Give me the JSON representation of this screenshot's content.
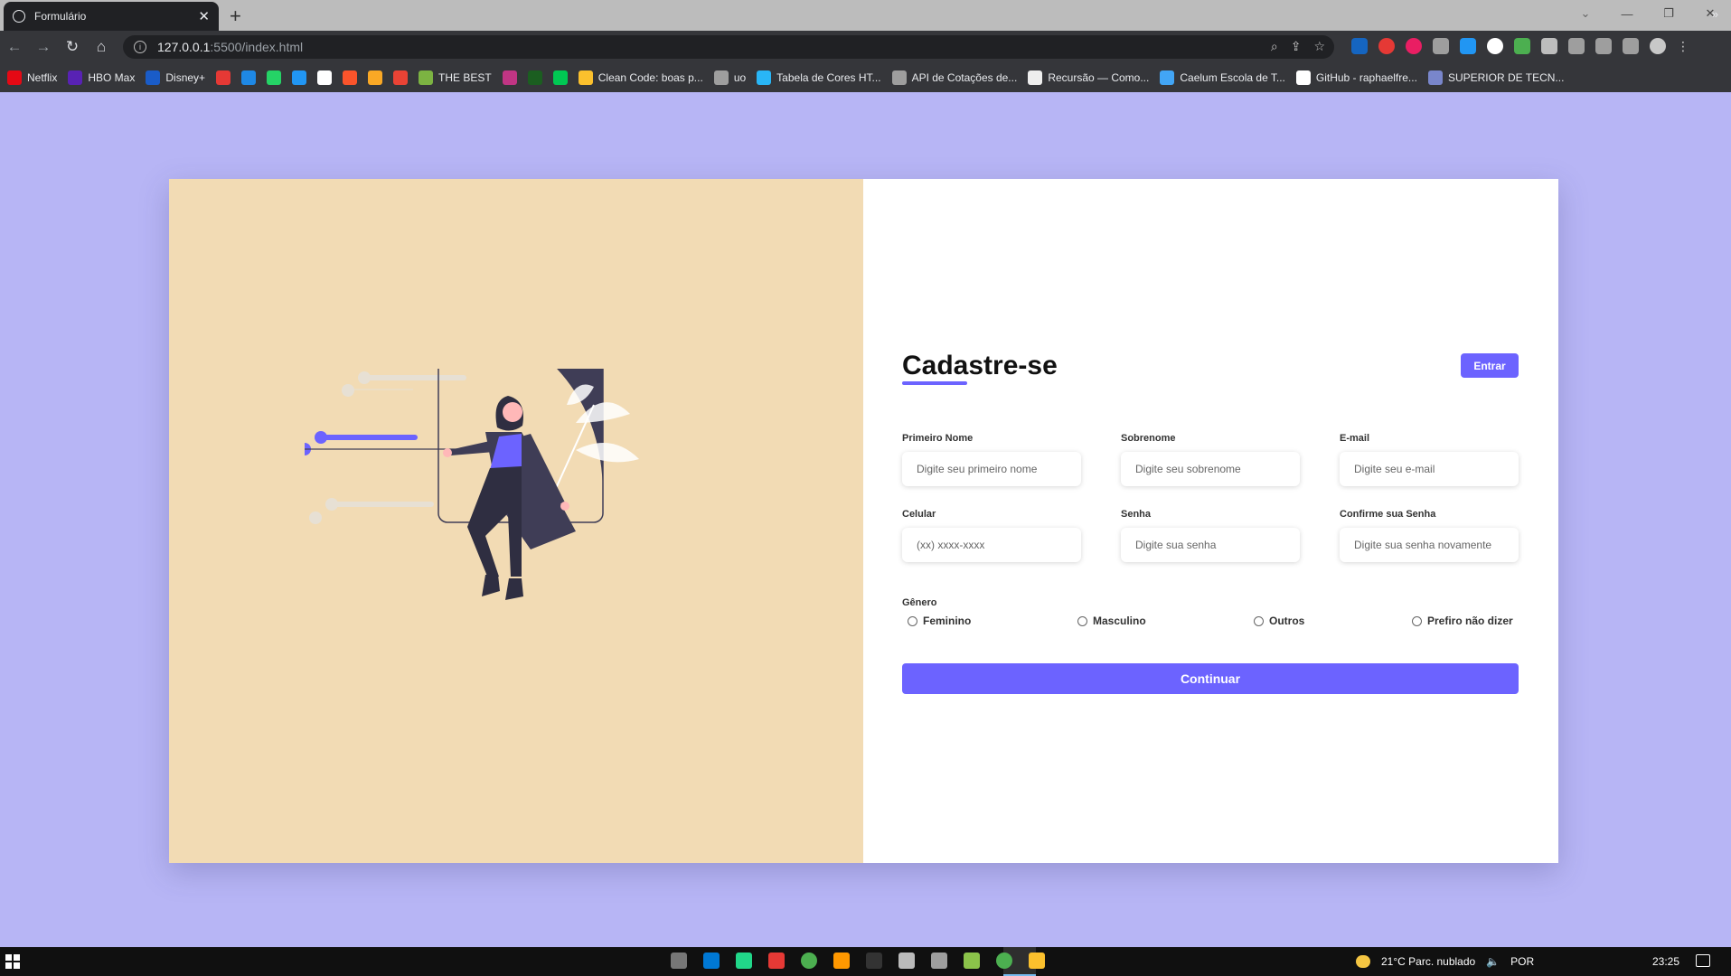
{
  "browser": {
    "tab_title": "Formulário",
    "new_tab": "+",
    "url_host": "127.0.0.1",
    "url_path": ":5500/index.html",
    "window_controls": {
      "tabs_list": "⌄",
      "minimize": "—",
      "restore": "❐",
      "close": "✕"
    }
  },
  "bookmarks": [
    {
      "label": "Netflix",
      "icon": "netflix-icon",
      "color": "#e50914"
    },
    {
      "label": "HBO Max",
      "icon": "hbomax-icon",
      "color": "#5822b4"
    },
    {
      "label": "Disney+",
      "icon": "disney-icon",
      "color": "#1a5cc8"
    },
    {
      "label": "",
      "icon": "star-icon",
      "color": "#e53935"
    },
    {
      "label": "",
      "icon": "play-icon",
      "color": "#1e88e5"
    },
    {
      "label": "",
      "icon": "whatsapp-icon",
      "color": "#25d366"
    },
    {
      "label": "",
      "icon": "edge-icon",
      "color": "#2196f3"
    },
    {
      "label": "",
      "icon": "amazon-icon",
      "color": "#ffffff"
    },
    {
      "label": "",
      "icon": "brave-icon",
      "color": "#fb542b"
    },
    {
      "label": "",
      "icon": "pencil-icon",
      "color": "#f9a825"
    },
    {
      "label": "",
      "icon": "gmail-icon",
      "color": "#ea4335"
    },
    {
      "label": "THE BEST",
      "icon": "grid-icon",
      "color": "#7cb342"
    },
    {
      "label": "",
      "icon": "instagram-icon",
      "color": "#c13584"
    },
    {
      "label": "",
      "icon": "dark-app-icon",
      "color": "#1b5e20"
    },
    {
      "label": "",
      "icon": "green-app-icon",
      "color": "#00c853"
    },
    {
      "label": "Clean Code: boas p...",
      "icon": "behance-icon",
      "color": "#fbc02d"
    },
    {
      "label": "uo",
      "icon": "globe-icon",
      "color": "#9e9e9e"
    },
    {
      "label": "Tabela de Cores HT...",
      "icon": "swoosh-icon",
      "color": "#29b6f6"
    },
    {
      "label": "API de Cotações de...",
      "icon": "gear-icon",
      "color": "#9e9e9e"
    },
    {
      "label": "Recursão — Como...",
      "icon": "mask-icon",
      "color": "#eeeeee"
    },
    {
      "label": "Caelum Escola de T...",
      "icon": "caelum-icon",
      "color": "#42a5f5"
    },
    {
      "label": "GitHub - raphaelfre...",
      "icon": "github-icon",
      "color": "#ffffff"
    },
    {
      "label": "SUPERIOR DE TECN...",
      "icon": "lion-icon",
      "color": "#7986cb"
    }
  ],
  "bookmarks_more": "»",
  "form": {
    "title": "Cadastre-se",
    "login_button": "Entrar",
    "fields": {
      "first_name": {
        "label": "Primeiro Nome",
        "placeholder": "Digite seu primeiro nome"
      },
      "last_name": {
        "label": "Sobrenome",
        "placeholder": "Digite seu sobrenome"
      },
      "email": {
        "label": "E-mail",
        "placeholder": "Digite seu e-mail"
      },
      "phone": {
        "label": "Celular",
        "placeholder": "(xx) xxxx-xxxx"
      },
      "password": {
        "label": "Senha",
        "placeholder": "Digite sua senha"
      },
      "confirm_password": {
        "label": "Confirme sua Senha",
        "placeholder": "Digite sua senha novamente"
      }
    },
    "gender": {
      "title": "Gênero",
      "options": [
        "Feminino",
        "Masculino",
        "Outros",
        "Prefiro não dizer"
      ]
    },
    "continue_button": "Continuar"
  },
  "taskbar": {
    "weather": "21°C  Parc. nublado",
    "language": "POR",
    "time": "23:25"
  },
  "colors": {
    "page_background": "#b7b5f5",
    "accent": "#6c63ff",
    "illustration_background": "#f2dbb4"
  }
}
